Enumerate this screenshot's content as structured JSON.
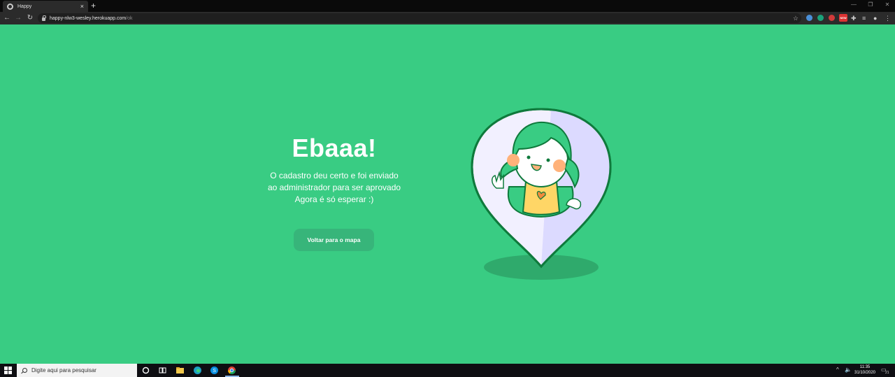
{
  "browser": {
    "tab_title": "Happy",
    "tab_close": "×",
    "new_tab": "+",
    "url_host": "happy-nlw3-wesley.herokuapp.com",
    "url_path": "/ok",
    "ext_badge": "NEW"
  },
  "page": {
    "headline": "Ebaaa!",
    "message_line1": "O cadastro deu certo e foi enviado",
    "message_line2": "ao administrador para ser aprovado",
    "message_line3": "Agora é só esperar :)",
    "back_button_label": "Voltar para o mapa"
  },
  "taskbar": {
    "search_placeholder": "Digite aqui para pesquisar",
    "time": "11:35",
    "date": "31/10/2020",
    "notification_count": "21"
  },
  "colors": {
    "background": "#39CC83",
    "button": "#37b57a",
    "pin_outline": "#0F7A3C",
    "pin_fill": "#F2F0FF",
    "pin_shade": "#DCDAFF",
    "hair": "#39CC83",
    "cheeks": "#FFB27A",
    "shirt": "#FFD666"
  }
}
